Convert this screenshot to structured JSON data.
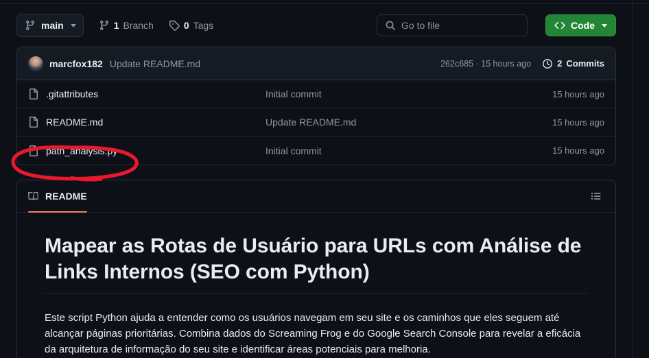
{
  "toolbar": {
    "branch_name": "main",
    "branch_icon": "git-branch-icon",
    "branch_caret_icon": "chevron-down-icon",
    "branches": {
      "count": "1",
      "label": "Branch",
      "icon": "git-branch-icon"
    },
    "tags": {
      "count": "0",
      "label": "Tags",
      "icon": "tag-icon"
    },
    "search": {
      "placeholder": "Go to file",
      "value": "",
      "icon": "search-icon"
    },
    "code_button": {
      "label": "Code",
      "icon": "code-brackets-icon",
      "caret_icon": "chevron-down-icon",
      "color": "#238636"
    }
  },
  "commit_bar": {
    "author": "marcfox182",
    "message": "Update README.md",
    "sha": "262c685",
    "separator": "·",
    "relative_time": "15 hours ago",
    "sha_line": "262c685 · 15 hours ago",
    "commits_count": "2",
    "commits_label": "Commits",
    "history_icon": "clock-history-icon"
  },
  "files": [
    {
      "icon": "file-icon",
      "name": ".gitattributes",
      "message": "Initial commit",
      "time": "15 hours ago",
      "highlighted": false
    },
    {
      "icon": "file-icon",
      "name": "README.md",
      "message": "Update README.md",
      "time": "15 hours ago",
      "highlighted": false
    },
    {
      "icon": "file-icon",
      "name": "path_analysis.py",
      "message": "Initial commit",
      "time": "15 hours ago",
      "highlighted": true
    }
  ],
  "readme": {
    "tab_label": "README",
    "tab_icon": "book-icon",
    "outline_icon": "list-outline-icon",
    "accent_color": "#f78166",
    "title": "Mapear as Rotas de Usuário para URLs com Análise de Links Internos (SEO com Python)",
    "paragraph": "Este script Python ajuda a entender como os usuários navegam em seu site e os caminhos que eles seguem até alcançar páginas prioritárias. Combina dados do Screaming Frog e do Google Search Console para revelar a eficácia da arquitetura de informação do seu site e identificar áreas potenciais para melhoria."
  },
  "annotation": {
    "shape": "hand-drawn-ellipse",
    "color": "#e8192c",
    "target": "path_analysis.py"
  }
}
